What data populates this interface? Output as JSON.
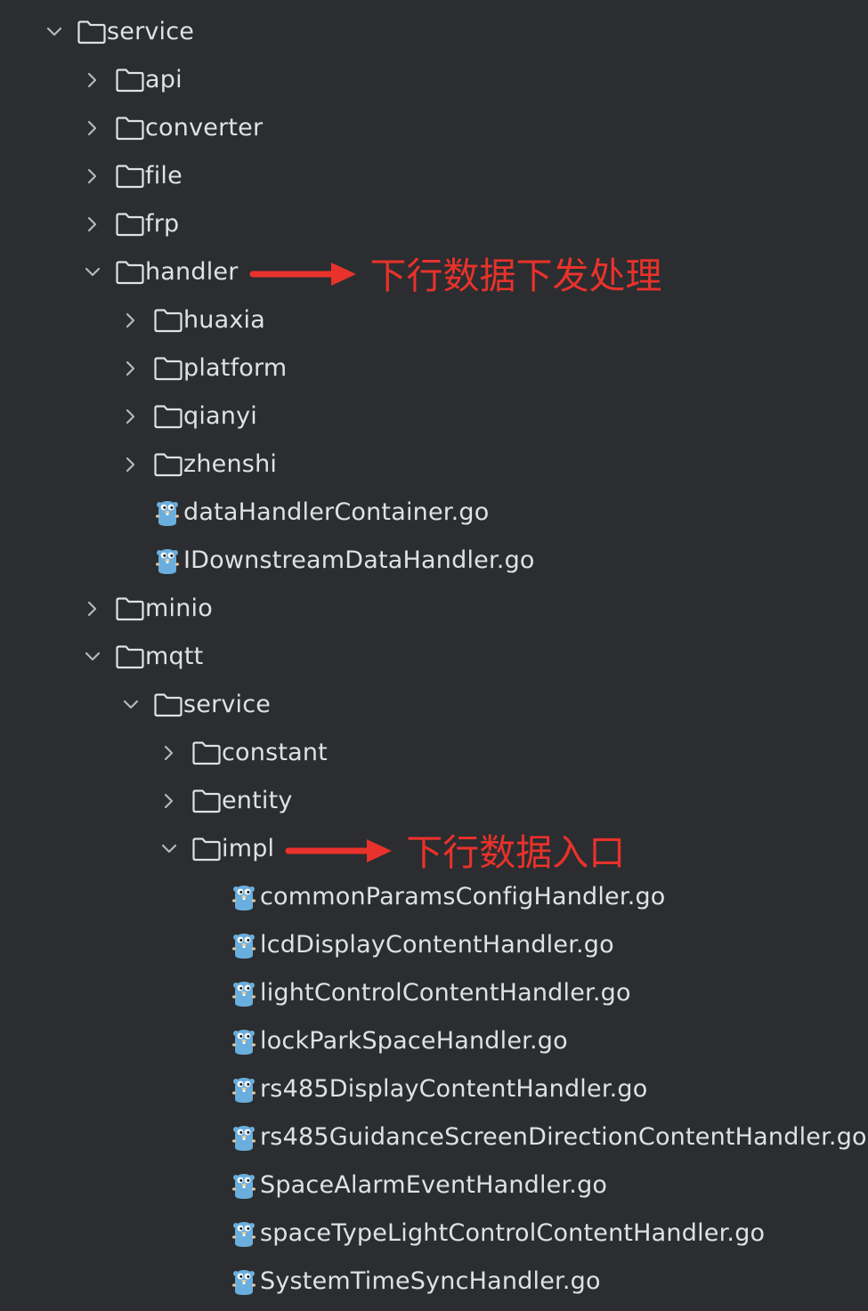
{
  "tree": [
    {
      "label": "service",
      "type": "folder",
      "depth": 0,
      "expanded": true,
      "name": "tree-item-service"
    },
    {
      "label": "api",
      "type": "folder",
      "depth": 1,
      "expanded": false,
      "name": "tree-item-api"
    },
    {
      "label": "converter",
      "type": "folder",
      "depth": 1,
      "expanded": false,
      "name": "tree-item-converter"
    },
    {
      "label": "file",
      "type": "folder",
      "depth": 1,
      "expanded": false,
      "name": "tree-item-file"
    },
    {
      "label": "frp",
      "type": "folder",
      "depth": 1,
      "expanded": false,
      "name": "tree-item-frp"
    },
    {
      "label": "handler",
      "type": "folder",
      "depth": 1,
      "expanded": true,
      "name": "tree-item-handler"
    },
    {
      "label": "huaxia",
      "type": "folder",
      "depth": 2,
      "expanded": false,
      "name": "tree-item-huaxia"
    },
    {
      "label": "platform",
      "type": "folder",
      "depth": 2,
      "expanded": false,
      "name": "tree-item-platform"
    },
    {
      "label": "qianyi",
      "type": "folder",
      "depth": 2,
      "expanded": false,
      "name": "tree-item-qianyi"
    },
    {
      "label": "zhenshi",
      "type": "folder",
      "depth": 2,
      "expanded": false,
      "name": "tree-item-zhenshi"
    },
    {
      "label": "dataHandlerContainer.go",
      "type": "file",
      "depth": 2,
      "name": "tree-item-datahandlercontainer-go"
    },
    {
      "label": "IDownstreamDataHandler.go",
      "type": "file",
      "depth": 2,
      "name": "tree-item-idownstreamdatahandler-go"
    },
    {
      "label": "minio",
      "type": "folder",
      "depth": 1,
      "expanded": false,
      "name": "tree-item-minio"
    },
    {
      "label": "mqtt",
      "type": "folder",
      "depth": 1,
      "expanded": true,
      "name": "tree-item-mqtt"
    },
    {
      "label": "service",
      "type": "folder",
      "depth": 2,
      "expanded": true,
      "name": "tree-item-mqtt-service"
    },
    {
      "label": "constant",
      "type": "folder",
      "depth": 3,
      "expanded": false,
      "name": "tree-item-constant"
    },
    {
      "label": "entity",
      "type": "folder",
      "depth": 3,
      "expanded": false,
      "name": "tree-item-entity"
    },
    {
      "label": "impl",
      "type": "folder",
      "depth": 3,
      "expanded": true,
      "name": "tree-item-impl"
    },
    {
      "label": "commonParamsConfigHandler.go",
      "type": "file",
      "depth": 4,
      "name": "tree-item-commonparamsconfighandler-go"
    },
    {
      "label": "lcdDisplayContentHandler.go",
      "type": "file",
      "depth": 4,
      "name": "tree-item-lcddisplaycontenthandler-go"
    },
    {
      "label": "lightControlContentHandler.go",
      "type": "file",
      "depth": 4,
      "name": "tree-item-lightcontrolcontenthandler-go"
    },
    {
      "label": "lockParkSpaceHandler.go",
      "type": "file",
      "depth": 4,
      "name": "tree-item-lockparkspacehandler-go"
    },
    {
      "label": "rs485DisplayContentHandler.go",
      "type": "file",
      "depth": 4,
      "name": "tree-item-rs485displaycontenthandler-go"
    },
    {
      "label": "rs485GuidanceScreenDirectionContentHandler.go",
      "type": "file",
      "depth": 4,
      "name": "tree-item-rs485guidancescreendirectioncontenthandler-go"
    },
    {
      "label": "SpaceAlarmEventHandler.go",
      "type": "file",
      "depth": 4,
      "name": "tree-item-spacealarmeventhandler-go"
    },
    {
      "label": "spaceTypeLightControlContentHandler.go",
      "type": "file",
      "depth": 4,
      "name": "tree-item-spacetypelightcontrolcontenthandler-go"
    },
    {
      "label": "SystemTimeSyncHandler.go",
      "type": "file",
      "depth": 4,
      "name": "tree-item-systemtimesynchandler-go"
    }
  ],
  "annotations": [
    {
      "text": "下行数据下发处理",
      "target_row": 5,
      "name": "annotation-handler"
    },
    {
      "text": "下行数据入口",
      "target_row": 17,
      "name": "annotation-impl"
    }
  ],
  "colors": {
    "background": "#2b2d30",
    "text": "#dfe1e5",
    "icon": "#dfe1e5",
    "chevron": "#b4b8bf",
    "annotation": "#e8322b",
    "gopher": "#6aaedd"
  },
  "icons": {
    "folder": "folder-icon",
    "file": "go-gopher-icon",
    "expanded": "chevron-down-icon",
    "collapsed": "chevron-right-icon",
    "annotation": "arrow-right-icon"
  }
}
